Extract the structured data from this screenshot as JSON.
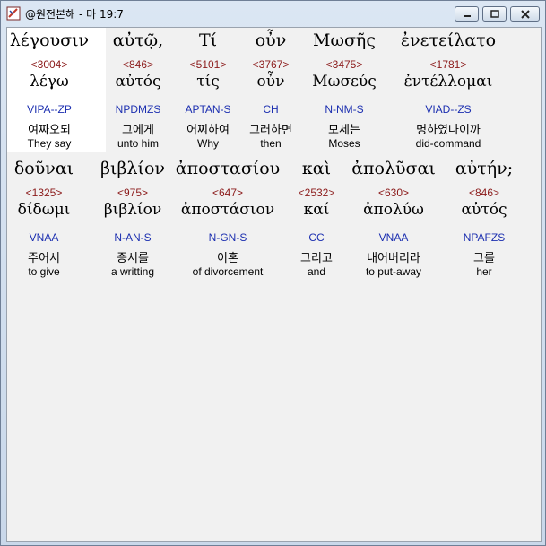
{
  "window": {
    "title": "@원전본해 - 마 19:7"
  },
  "words": [
    {
      "greek": "λέγουσιν",
      "number": "<3004>",
      "lemma": "λέγω",
      "code": "VIPA--ZP",
      "korean": "여짜오되",
      "english": "They say"
    },
    {
      "greek": "αὐτῷ,",
      "number": "<846>",
      "lemma": "αὐτός",
      "code": "NPDMZS",
      "korean": "그에게",
      "english": "unto him"
    },
    {
      "greek": "Τί",
      "number": "<5101>",
      "lemma": "τίς",
      "code": "APTAN-S",
      "korean": "어찌하여",
      "english": "Why"
    },
    {
      "greek": "οὖν",
      "number": "<3767>",
      "lemma": "οὖν",
      "code": "CH",
      "korean": "그러하면",
      "english": "then"
    },
    {
      "greek": "Μωσῆς",
      "number": "<3475>",
      "lemma": "Μωσεύς",
      "code": "N-NM-S",
      "korean": "모세는",
      "english": "Moses"
    },
    {
      "greek": "ἐνετείλατο",
      "number": "<1781>",
      "lemma": "ἐντέλλομαι",
      "code": "VIAD--ZS",
      "korean": "명하였나이까",
      "english": "did-command"
    },
    {
      "greek": "δοῦναι",
      "number": "<1325>",
      "lemma": "δίδωμι",
      "code": "VNAA",
      "korean": "주어서",
      "english": "to give"
    },
    {
      "greek": "βιβλίον",
      "number": "<975>",
      "lemma": "βιβλίον",
      "code": "N-AN-S",
      "korean": "증서를",
      "english": "a writting"
    },
    {
      "greek": "ἀποστασίου",
      "number": "<647>",
      "lemma": "ἀποστάσιον",
      "code": "N-GN-S",
      "korean": "이혼",
      "english": "of divorcement"
    },
    {
      "greek": "καὶ",
      "number": "<2532>",
      "lemma": "καί",
      "code": "CC",
      "korean": "그리고",
      "english": "and"
    },
    {
      "greek": "ἀπολῦσαι",
      "number": "<630>",
      "lemma": "ἀπολύω",
      "code": "VNAA",
      "korean": "내어버리라",
      "english": "to put-away"
    },
    {
      "greek": "αὐτήν;",
      "number": "<846>",
      "lemma": "αὐτός",
      "code": "NPAFZS",
      "korean": "그를",
      "english": "her"
    }
  ]
}
